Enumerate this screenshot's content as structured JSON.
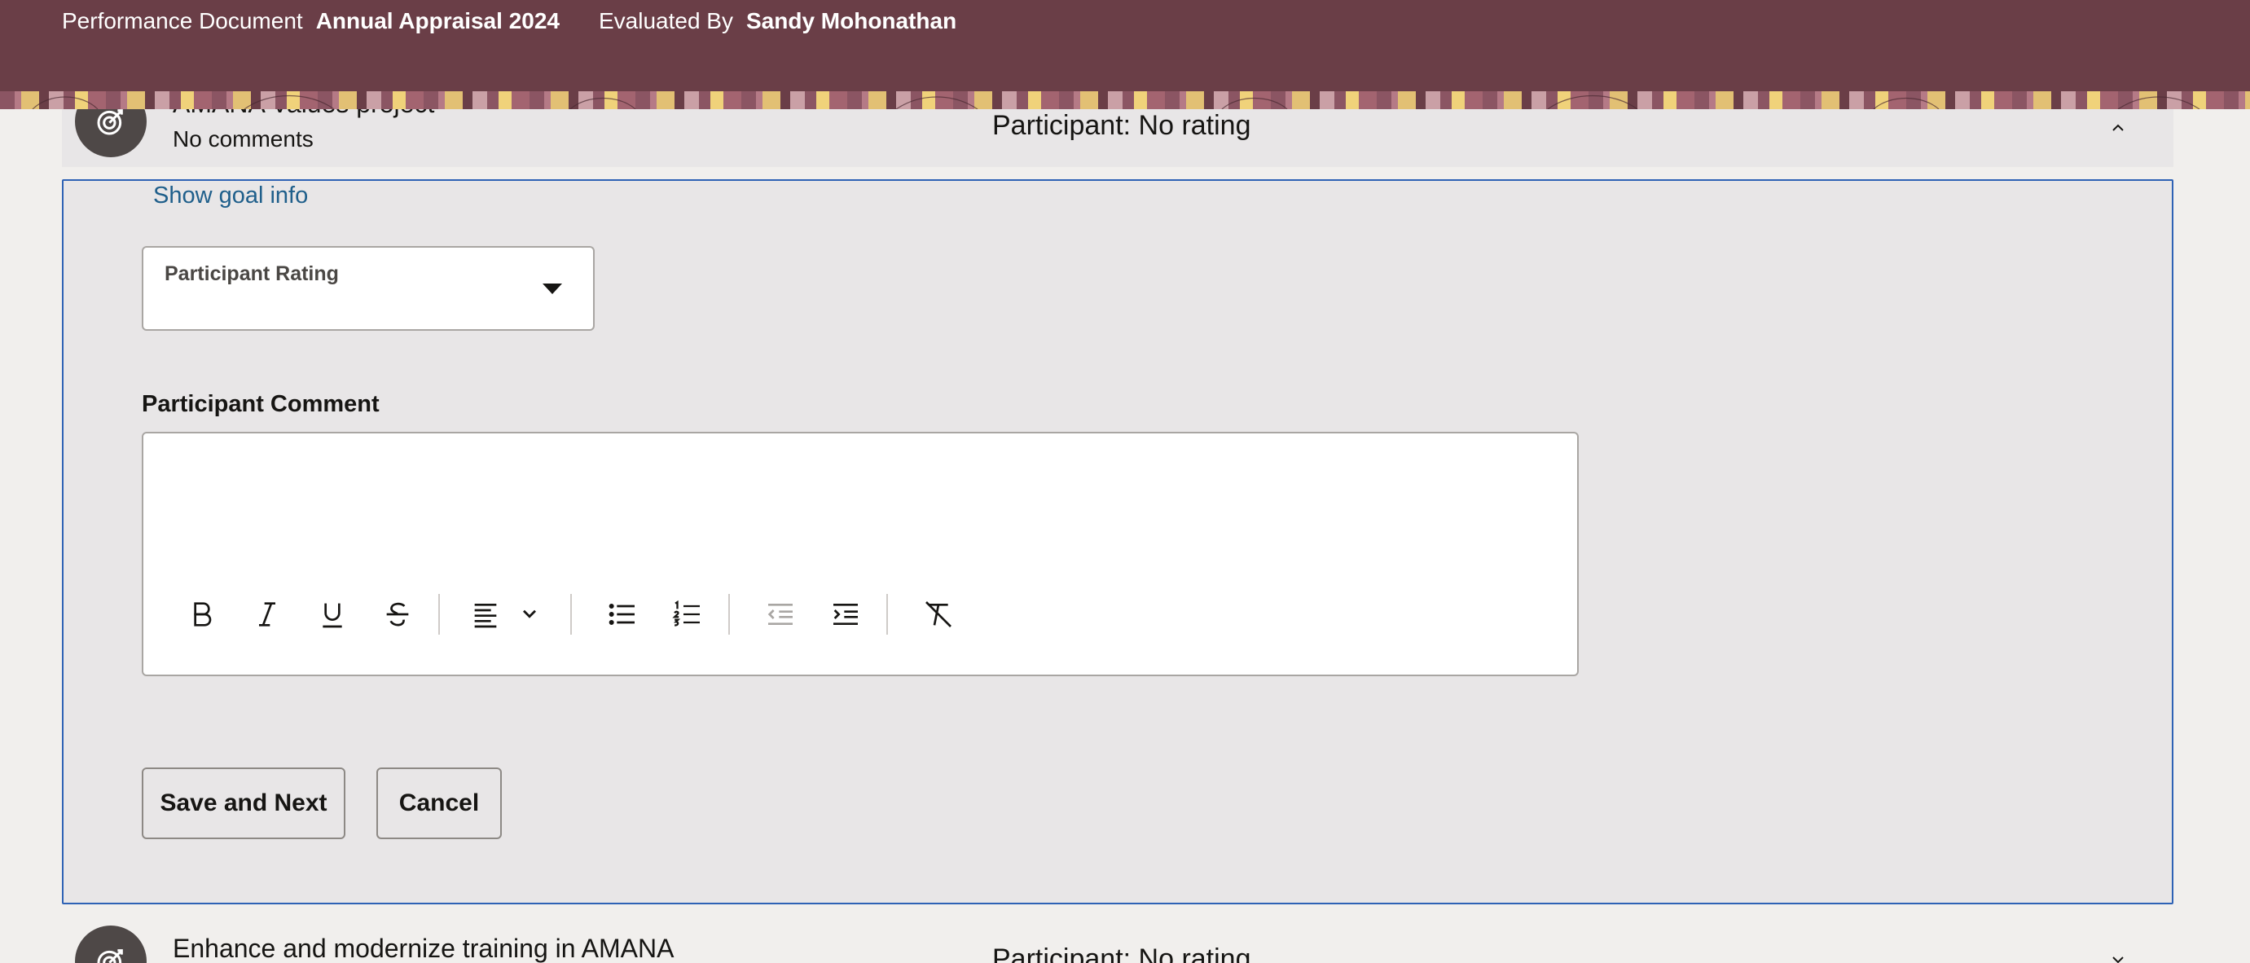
{
  "header": {
    "doc_label": "Performance Document",
    "doc_value": "Annual Appraisal 2024",
    "eval_label": "Evaluated By",
    "eval_value": "Sandy Mohonathan"
  },
  "goal_top": {
    "title": "AMANA Values project",
    "comments": "No comments",
    "rating": "Participant: No rating",
    "icon": "target-icon",
    "chevron": "chevron-up-icon"
  },
  "panel": {
    "show_goal_info": "Show goal info",
    "rating_label": "Participant Rating",
    "rating_value": "",
    "comment_label": "Participant Comment",
    "comment_value": "",
    "toolbar": [
      "bold-icon",
      "italic-icon",
      "underline-icon",
      "strikethrough-icon",
      "align-left-icon",
      "chevron-down-icon",
      "bullet-list-icon",
      "numbered-list-icon",
      "outdent-icon",
      "indent-icon",
      "clear-formatting-icon"
    ],
    "save_label": "Save and Next",
    "cancel_label": "Cancel"
  },
  "goal_bottom": {
    "title": "Enhance and modernize training in AMANA",
    "rating": "Participant: No rating",
    "icon": "target-icon",
    "chevron": "chevron-down-icon"
  },
  "colors": {
    "header_bg": "#6a3e47",
    "panel_border": "#2e62b5",
    "link": "#1f5f8b"
  }
}
